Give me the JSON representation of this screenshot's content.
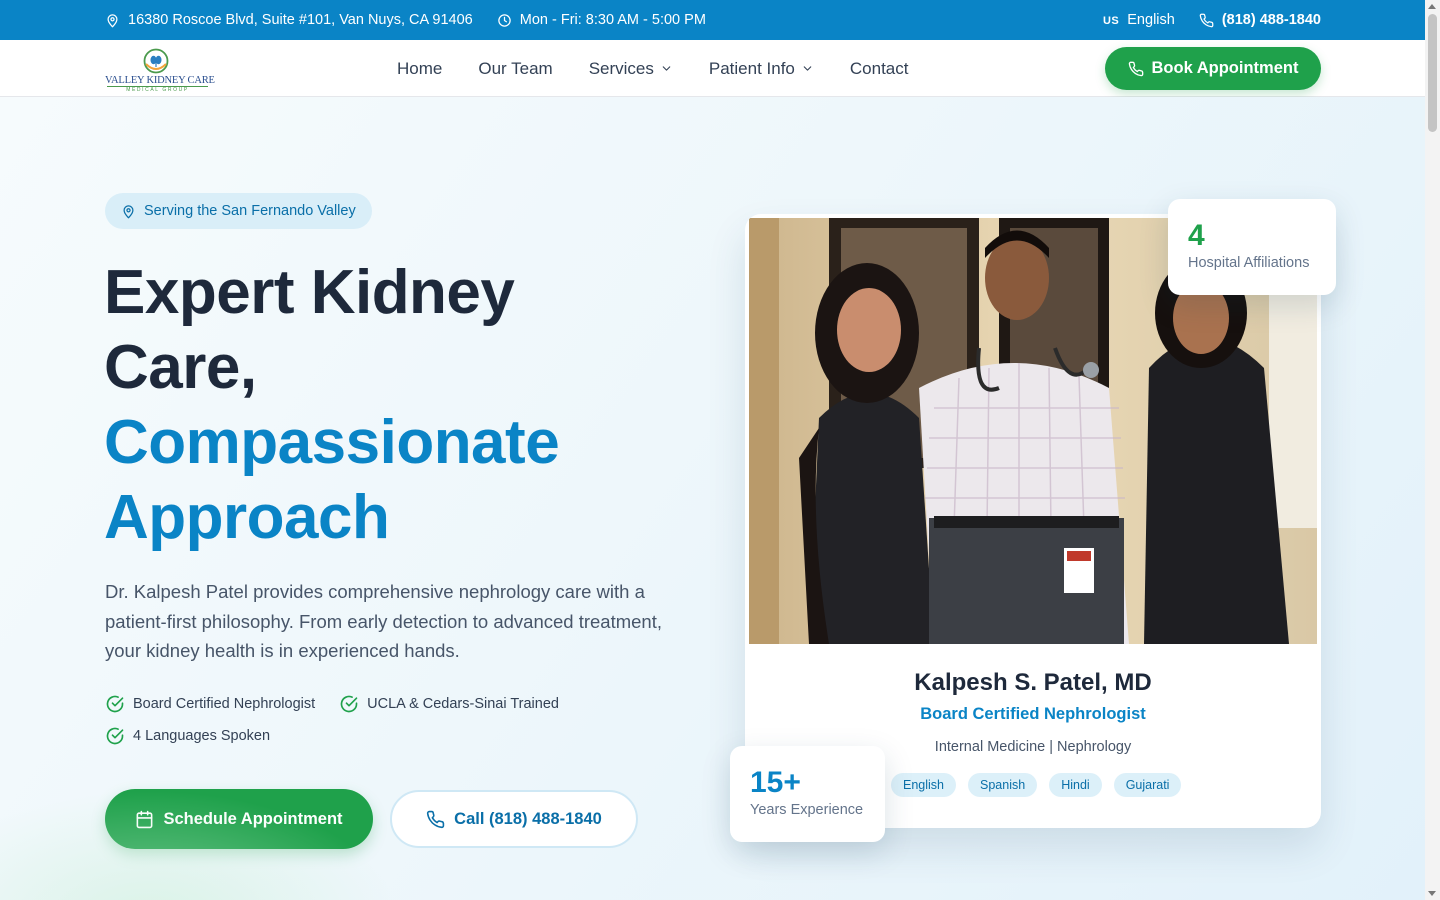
{
  "topbar": {
    "address": "16380 Roscoe Blvd, Suite #101, Van Nuys, CA 91406",
    "hours": "Mon - Fri: 8:30 AM - 5:00 PM",
    "language_flag": "US",
    "language": "English",
    "phone": "(818) 488-1840"
  },
  "logo": {
    "name": "VALLEY KIDNEY CARE",
    "subtitle": "MEDICAL GROUP"
  },
  "nav": {
    "items": [
      "Home",
      "Our Team",
      "Services",
      "Patient Info",
      "Contact"
    ],
    "book_label": "Book Appointment"
  },
  "hero": {
    "location_pill": "Serving the San Fernando Valley",
    "headline_line1": "Expert Kidney",
    "headline_line2": "Care,",
    "headline_accent1": "Compassionate",
    "headline_accent2": "Approach",
    "description": "Dr. Kalpesh Patel provides comprehensive nephrology care with a patient-first philosophy. From early detection to advanced treatment, your kidney health is in experienced hands.",
    "checks": [
      "Board Certified Nephrologist",
      "UCLA & Cedars-Sinai Trained",
      "4 Languages Spoken"
    ],
    "schedule_label": "Schedule Appointment",
    "call_label": "Call (818) 488-1840"
  },
  "doctor": {
    "name": "Kalpesh S. Patel, MD",
    "title": "Board Certified Nephrologist",
    "specialties": "Internal Medicine | Nephrology",
    "languages": [
      "English",
      "Spanish",
      "Hindi",
      "Gujarati"
    ]
  },
  "stats": {
    "hospitals_value": "4",
    "hospitals_label": "Hospital Affiliations",
    "experience_value": "15+",
    "experience_label": "Years Experience"
  },
  "colors": {
    "brand_blue": "#0a84c6",
    "brand_green": "#1fa14b",
    "text_dark": "#1e293b"
  }
}
